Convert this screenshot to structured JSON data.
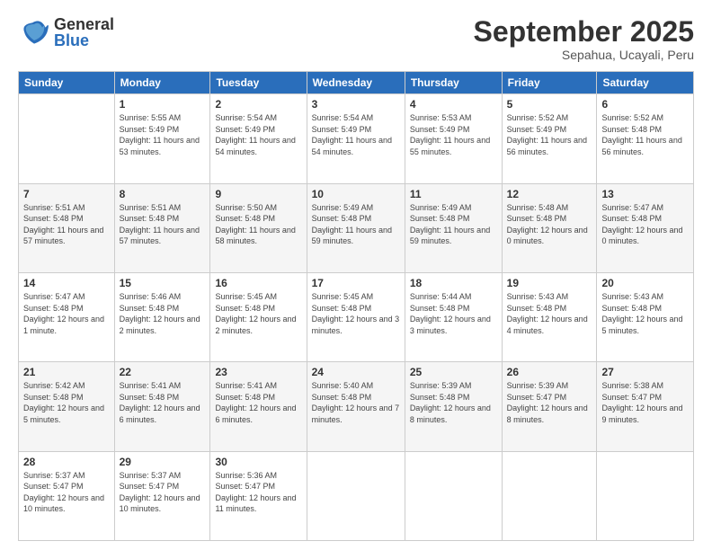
{
  "logo": {
    "general": "General",
    "blue": "Blue"
  },
  "header": {
    "month": "September 2025",
    "location": "Sepahua, Ucayali, Peru"
  },
  "weekdays": [
    "Sunday",
    "Monday",
    "Tuesday",
    "Wednesday",
    "Thursday",
    "Friday",
    "Saturday"
  ],
  "weeks": [
    [
      {
        "day": "",
        "sunrise": "",
        "sunset": "",
        "daylight": ""
      },
      {
        "day": "1",
        "sunrise": "Sunrise: 5:55 AM",
        "sunset": "Sunset: 5:49 PM",
        "daylight": "Daylight: 11 hours and 53 minutes."
      },
      {
        "day": "2",
        "sunrise": "Sunrise: 5:54 AM",
        "sunset": "Sunset: 5:49 PM",
        "daylight": "Daylight: 11 hours and 54 minutes."
      },
      {
        "day": "3",
        "sunrise": "Sunrise: 5:54 AM",
        "sunset": "Sunset: 5:49 PM",
        "daylight": "Daylight: 11 hours and 54 minutes."
      },
      {
        "day": "4",
        "sunrise": "Sunrise: 5:53 AM",
        "sunset": "Sunset: 5:49 PM",
        "daylight": "Daylight: 11 hours and 55 minutes."
      },
      {
        "day": "5",
        "sunrise": "Sunrise: 5:52 AM",
        "sunset": "Sunset: 5:49 PM",
        "daylight": "Daylight: 11 hours and 56 minutes."
      },
      {
        "day": "6",
        "sunrise": "Sunrise: 5:52 AM",
        "sunset": "Sunset: 5:48 PM",
        "daylight": "Daylight: 11 hours and 56 minutes."
      }
    ],
    [
      {
        "day": "7",
        "sunrise": "Sunrise: 5:51 AM",
        "sunset": "Sunset: 5:48 PM",
        "daylight": "Daylight: 11 hours and 57 minutes."
      },
      {
        "day": "8",
        "sunrise": "Sunrise: 5:51 AM",
        "sunset": "Sunset: 5:48 PM",
        "daylight": "Daylight: 11 hours and 57 minutes."
      },
      {
        "day": "9",
        "sunrise": "Sunrise: 5:50 AM",
        "sunset": "Sunset: 5:48 PM",
        "daylight": "Daylight: 11 hours and 58 minutes."
      },
      {
        "day": "10",
        "sunrise": "Sunrise: 5:49 AM",
        "sunset": "Sunset: 5:48 PM",
        "daylight": "Daylight: 11 hours and 59 minutes."
      },
      {
        "day": "11",
        "sunrise": "Sunrise: 5:49 AM",
        "sunset": "Sunset: 5:48 PM",
        "daylight": "Daylight: 11 hours and 59 minutes."
      },
      {
        "day": "12",
        "sunrise": "Sunrise: 5:48 AM",
        "sunset": "Sunset: 5:48 PM",
        "daylight": "Daylight: 12 hours and 0 minutes."
      },
      {
        "day": "13",
        "sunrise": "Sunrise: 5:47 AM",
        "sunset": "Sunset: 5:48 PM",
        "daylight": "Daylight: 12 hours and 0 minutes."
      }
    ],
    [
      {
        "day": "14",
        "sunrise": "Sunrise: 5:47 AM",
        "sunset": "Sunset: 5:48 PM",
        "daylight": "Daylight: 12 hours and 1 minute."
      },
      {
        "day": "15",
        "sunrise": "Sunrise: 5:46 AM",
        "sunset": "Sunset: 5:48 PM",
        "daylight": "Daylight: 12 hours and 2 minutes."
      },
      {
        "day": "16",
        "sunrise": "Sunrise: 5:45 AM",
        "sunset": "Sunset: 5:48 PM",
        "daylight": "Daylight: 12 hours and 2 minutes."
      },
      {
        "day": "17",
        "sunrise": "Sunrise: 5:45 AM",
        "sunset": "Sunset: 5:48 PM",
        "daylight": "Daylight: 12 hours and 3 minutes."
      },
      {
        "day": "18",
        "sunrise": "Sunrise: 5:44 AM",
        "sunset": "Sunset: 5:48 PM",
        "daylight": "Daylight: 12 hours and 3 minutes."
      },
      {
        "day": "19",
        "sunrise": "Sunrise: 5:43 AM",
        "sunset": "Sunset: 5:48 PM",
        "daylight": "Daylight: 12 hours and 4 minutes."
      },
      {
        "day": "20",
        "sunrise": "Sunrise: 5:43 AM",
        "sunset": "Sunset: 5:48 PM",
        "daylight": "Daylight: 12 hours and 5 minutes."
      }
    ],
    [
      {
        "day": "21",
        "sunrise": "Sunrise: 5:42 AM",
        "sunset": "Sunset: 5:48 PM",
        "daylight": "Daylight: 12 hours and 5 minutes."
      },
      {
        "day": "22",
        "sunrise": "Sunrise: 5:41 AM",
        "sunset": "Sunset: 5:48 PM",
        "daylight": "Daylight: 12 hours and 6 minutes."
      },
      {
        "day": "23",
        "sunrise": "Sunrise: 5:41 AM",
        "sunset": "Sunset: 5:48 PM",
        "daylight": "Daylight: 12 hours and 6 minutes."
      },
      {
        "day": "24",
        "sunrise": "Sunrise: 5:40 AM",
        "sunset": "Sunset: 5:48 PM",
        "daylight": "Daylight: 12 hours and 7 minutes."
      },
      {
        "day": "25",
        "sunrise": "Sunrise: 5:39 AM",
        "sunset": "Sunset: 5:48 PM",
        "daylight": "Daylight: 12 hours and 8 minutes."
      },
      {
        "day": "26",
        "sunrise": "Sunrise: 5:39 AM",
        "sunset": "Sunset: 5:47 PM",
        "daylight": "Daylight: 12 hours and 8 minutes."
      },
      {
        "day": "27",
        "sunrise": "Sunrise: 5:38 AM",
        "sunset": "Sunset: 5:47 PM",
        "daylight": "Daylight: 12 hours and 9 minutes."
      }
    ],
    [
      {
        "day": "28",
        "sunrise": "Sunrise: 5:37 AM",
        "sunset": "Sunset: 5:47 PM",
        "daylight": "Daylight: 12 hours and 10 minutes."
      },
      {
        "day": "29",
        "sunrise": "Sunrise: 5:37 AM",
        "sunset": "Sunset: 5:47 PM",
        "daylight": "Daylight: 12 hours and 10 minutes."
      },
      {
        "day": "30",
        "sunrise": "Sunrise: 5:36 AM",
        "sunset": "Sunset: 5:47 PM",
        "daylight": "Daylight: 12 hours and 11 minutes."
      },
      {
        "day": "",
        "sunrise": "",
        "sunset": "",
        "daylight": ""
      },
      {
        "day": "",
        "sunrise": "",
        "sunset": "",
        "daylight": ""
      },
      {
        "day": "",
        "sunrise": "",
        "sunset": "",
        "daylight": ""
      },
      {
        "day": "",
        "sunrise": "",
        "sunset": "",
        "daylight": ""
      }
    ]
  ]
}
